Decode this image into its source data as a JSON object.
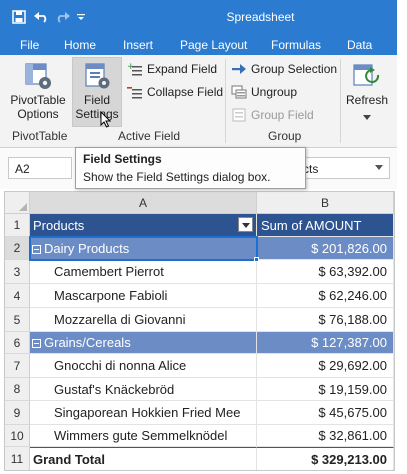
{
  "app": {
    "title": "Spreadsheet",
    "accent": "#2b7bd0"
  },
  "qat": {
    "save_icon": "save-icon",
    "undo_icon": "undo-icon",
    "redo_icon": "redo-icon",
    "customize_icon": "customize-qat-icon"
  },
  "menu": {
    "items": [
      "File",
      "Home",
      "Insert",
      "Page Layout",
      "Formulas",
      "Data"
    ]
  },
  "ribbon": {
    "pivottable_options": {
      "line1": "PivotTable",
      "line2": "Options",
      "icon": "pivottable-options-icon"
    },
    "field_settings": {
      "line1": "Field",
      "line2": "Settings",
      "icon": "field-settings-icon"
    },
    "expand_field": "Expand Field",
    "collapse_field": "Collapse Field",
    "group_selection": "Group Selection",
    "ungroup": "Ungroup",
    "group_field": "Group Field",
    "refresh": "Refresh",
    "groups": {
      "pivottable": "PivotTable",
      "active_field": "Active Field",
      "group": "Group"
    }
  },
  "formula_bar": {
    "name_box": "A2",
    "value": "Products"
  },
  "tooltip": {
    "title": "Field Settings",
    "text": "Show the Field Settings dialog box."
  },
  "grid": {
    "columns": [
      "A",
      "B"
    ],
    "rows": [
      {
        "num": "1",
        "a": "Products",
        "b": "Sum of AMOUNT",
        "type": "header"
      },
      {
        "num": "2",
        "a": "Dairy Products",
        "b": "$ 201,826.00",
        "type": "category"
      },
      {
        "num": "3",
        "a": "Camembert Pierrot",
        "b": "$ 63,392.00",
        "type": "item"
      },
      {
        "num": "4",
        "a": "Mascarpone Fabioli",
        "b": "$ 62,246.00",
        "type": "item"
      },
      {
        "num": "5",
        "a": "Mozzarella di Giovanni",
        "b": "$ 76,188.00",
        "type": "item"
      },
      {
        "num": "6",
        "a": "Grains/Cereals",
        "b": "$ 127,387.00",
        "type": "category"
      },
      {
        "num": "7",
        "a": "Gnocchi di nonna Alice",
        "b": "$ 29,692.00",
        "type": "item"
      },
      {
        "num": "8",
        "a": "Gustaf's Knäckebröd",
        "b": "$ 19,159.00",
        "type": "item"
      },
      {
        "num": "9",
        "a": "Singaporean Hokkien Fried Mee",
        "b": "$ 45,675.00",
        "type": "item"
      },
      {
        "num": "10",
        "a": "Wimmers gute Semmelknödel",
        "b": "$ 32,861.00",
        "type": "item"
      },
      {
        "num": "11",
        "a": "Grand Total",
        "b": "$ 329,213.00",
        "type": "total"
      }
    ],
    "colors": {
      "header": "#2d5390",
      "category": "#6c8cc6",
      "selection": "#1f6fcf"
    }
  }
}
